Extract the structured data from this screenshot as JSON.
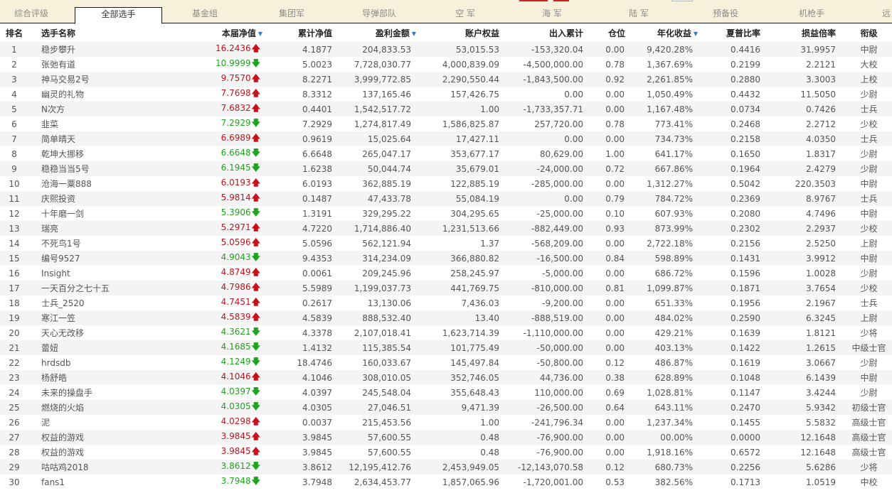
{
  "tabs": [
    {
      "label": "综合评级",
      "active": false
    },
    {
      "label": "全部选手",
      "active": true
    },
    {
      "label": "基金组",
      "active": false
    },
    {
      "label": "集团军",
      "active": false
    },
    {
      "label": "导弹部队",
      "active": false
    },
    {
      "label": "空 军",
      "active": false
    },
    {
      "label": "海 军",
      "active": false
    },
    {
      "label": "陆 军",
      "active": false
    },
    {
      "label": "预备役",
      "active": false
    },
    {
      "label": "机枪手",
      "active": false
    },
    {
      "label": "远",
      "active": false
    }
  ],
  "columns": {
    "rank": "排名",
    "name": "选手名称",
    "nav": "本届净值",
    "cum_nav": "累计净值",
    "profit": "盈利金额",
    "equity": "账户权益",
    "inout": "出入累计",
    "position": "仓位",
    "annual": "年化收益",
    "sharpe": "夏普比率",
    "ratio": "损益倍率",
    "title": "衔级"
  },
  "sorted_columns": [
    "nav",
    "profit",
    "annual"
  ],
  "colors": {
    "up": "#c8121b",
    "down": "#1ea51e",
    "sort_icon": "#2b7bd6",
    "tab_bg": "#f7f1dc"
  },
  "rows": [
    {
      "rank": "1",
      "name": "稳步攀升",
      "nav": "16.2436",
      "dir": "up",
      "cum_nav": "4.1877",
      "profit": "204,833.53",
      "equity": "53,015.53",
      "inout": "-153,320.04",
      "position": "0.00",
      "annual": "9,420.28%",
      "sharpe": "0.4416",
      "ratio": "31.9957",
      "title": "中尉"
    },
    {
      "rank": "2",
      "name": "张弛有道",
      "nav": "10.9999",
      "dir": "down",
      "cum_nav": "5.0023",
      "profit": "7,728,030.77",
      "equity": "4,000,839.09",
      "inout": "-4,500,000.00",
      "position": "0.78",
      "annual": "1,367.69%",
      "sharpe": "0.2199",
      "ratio": "2.2121",
      "title": "大校"
    },
    {
      "rank": "3",
      "name": "神马交易2号",
      "nav": "9.7570",
      "dir": "up",
      "cum_nav": "8.2271",
      "profit": "3,999,772.85",
      "equity": "2,290,550.44",
      "inout": "-1,843,500.00",
      "position": "0.92",
      "annual": "2,261.85%",
      "sharpe": "0.2880",
      "ratio": "3.3003",
      "title": "上校"
    },
    {
      "rank": "4",
      "name": "幽灵的礼物",
      "nav": "7.7698",
      "dir": "up",
      "cum_nav": "8.3312",
      "profit": "137,165.46",
      "equity": "157,426.75",
      "inout": "0.00",
      "position": "0.00",
      "annual": "1,050.49%",
      "sharpe": "0.4432",
      "ratio": "11.5050",
      "title": "少尉"
    },
    {
      "rank": "5",
      "name": "N次方",
      "nav": "7.6832",
      "dir": "up",
      "cum_nav": "0.4401",
      "profit": "1,542,517.72",
      "equity": "1.00",
      "inout": "-1,733,357.71",
      "position": "0.00",
      "annual": "1,167.48%",
      "sharpe": "0.0734",
      "ratio": "0.7426",
      "title": "士兵"
    },
    {
      "rank": "6",
      "name": "韭菜",
      "nav": "7.2929",
      "dir": "down",
      "cum_nav": "7.2929",
      "profit": "1,274,817.49",
      "equity": "1,586,825.87",
      "inout": "257,720.00",
      "position": "0.78",
      "annual": "773.41%",
      "sharpe": "0.2468",
      "ratio": "2.2712",
      "title": "少校"
    },
    {
      "rank": "7",
      "name": "简单晴天",
      "nav": "6.6989",
      "dir": "up",
      "cum_nav": "0.9619",
      "profit": "15,025.64",
      "equity": "17,427.11",
      "inout": "0.00",
      "position": "0.00",
      "annual": "734.73%",
      "sharpe": "0.2158",
      "ratio": "4.0350",
      "title": "士兵"
    },
    {
      "rank": "8",
      "name": "乾坤大挪移",
      "nav": "6.6648",
      "dir": "down",
      "cum_nav": "6.6648",
      "profit": "265,047.17",
      "equity": "353,677.17",
      "inout": "80,629.00",
      "position": "1.00",
      "annual": "641.17%",
      "sharpe": "0.1650",
      "ratio": "1.8317",
      "title": "少尉"
    },
    {
      "rank": "9",
      "name": "稳稳当当5号",
      "nav": "6.1945",
      "dir": "down",
      "cum_nav": "1.6238",
      "profit": "50,044.74",
      "equity": "35,679.01",
      "inout": "-24,000.00",
      "position": "0.72",
      "annual": "667.86%",
      "sharpe": "0.1964",
      "ratio": "2.4279",
      "title": "少尉"
    },
    {
      "rank": "10",
      "name": "沧海一粟888",
      "nav": "6.0193",
      "dir": "up",
      "cum_nav": "6.0193",
      "profit": "362,885.19",
      "equity": "122,885.19",
      "inout": "-285,000.00",
      "position": "0.00",
      "annual": "1,312.27%",
      "sharpe": "0.5042",
      "ratio": "220.3503",
      "title": "中尉"
    },
    {
      "rank": "11",
      "name": "庆熙投资",
      "nav": "5.9814",
      "dir": "up",
      "cum_nav": "0.1487",
      "profit": "47,433.78",
      "equity": "55,084.19",
      "inout": "0.00",
      "position": "0.79",
      "annual": "784.72%",
      "sharpe": "0.2369",
      "ratio": "8.9767",
      "title": "士兵"
    },
    {
      "rank": "12",
      "name": "十年磨一剑",
      "nav": "5.3906",
      "dir": "down",
      "cum_nav": "1.3191",
      "profit": "329,295.22",
      "equity": "304,295.65",
      "inout": "-25,000.00",
      "position": "0.10",
      "annual": "607.93%",
      "sharpe": "0.2080",
      "ratio": "4.7496",
      "title": "中尉"
    },
    {
      "rank": "13",
      "name": "瑞亮",
      "nav": "5.2971",
      "dir": "up",
      "cum_nav": "4.7220",
      "profit": "1,714,886.40",
      "equity": "1,231,513.66",
      "inout": "-882,449.00",
      "position": "0.93",
      "annual": "873.99%",
      "sharpe": "0.2302",
      "ratio": "2.2937",
      "title": "少校"
    },
    {
      "rank": "14",
      "name": "不死鸟1号",
      "nav": "5.0596",
      "dir": "up",
      "cum_nav": "5.0596",
      "profit": "562,121.94",
      "equity": "1.37",
      "inout": "-568,209.00",
      "position": "0.00",
      "annual": "2,722.18%",
      "sharpe": "0.2156",
      "ratio": "2.5250",
      "title": "上尉"
    },
    {
      "rank": "15",
      "name": "编号9527",
      "nav": "4.9043",
      "dir": "down",
      "cum_nav": "9.4353",
      "profit": "314,234.09",
      "equity": "366,880.82",
      "inout": "-16,500.00",
      "position": "0.84",
      "annual": "598.89%",
      "sharpe": "0.1431",
      "ratio": "3.9912",
      "title": "中尉"
    },
    {
      "rank": "16",
      "name": "Insight",
      "nav": "4.8749",
      "dir": "up",
      "cum_nav": "0.0061",
      "profit": "209,245.96",
      "equity": "258,245.97",
      "inout": "-5,000.00",
      "position": "0.00",
      "annual": "686.72%",
      "sharpe": "0.1596",
      "ratio": "1.0028",
      "title": "少尉"
    },
    {
      "rank": "17",
      "name": "一天百分之七十五",
      "nav": "4.7986",
      "dir": "up",
      "cum_nav": "5.5989",
      "profit": "1,199,037.73",
      "equity": "441,769.75",
      "inout": "-810,000.00",
      "position": "0.81",
      "annual": "1,099.87%",
      "sharpe": "0.1871",
      "ratio": "3.7654",
      "title": "少校"
    },
    {
      "rank": "18",
      "name": "士兵_2520",
      "nav": "4.7451",
      "dir": "up",
      "cum_nav": "0.2617",
      "profit": "13,130.06",
      "equity": "7,436.03",
      "inout": "-9,200.00",
      "position": "0.00",
      "annual": "651.33%",
      "sharpe": "0.1956",
      "ratio": "2.1967",
      "title": "士兵"
    },
    {
      "rank": "19",
      "name": "寒江一笠",
      "nav": "4.5839",
      "dir": "up",
      "cum_nav": "4.5839",
      "profit": "888,532.40",
      "equity": "13.40",
      "inout": "-888,519.00",
      "position": "0.00",
      "annual": "484.02%",
      "sharpe": "0.2590",
      "ratio": "6.3245",
      "title": "上尉"
    },
    {
      "rank": "20",
      "name": "天心无改移",
      "nav": "4.3621",
      "dir": "down",
      "cum_nav": "4.3378",
      "profit": "2,107,018.41",
      "equity": "1,623,714.39",
      "inout": "-1,110,000.00",
      "position": "0.00",
      "annual": "429.21%",
      "sharpe": "0.1639",
      "ratio": "1.8121",
      "title": "少将"
    },
    {
      "rank": "21",
      "name": "蕾妞",
      "nav": "4.1685",
      "dir": "down",
      "cum_nav": "1.4132",
      "profit": "115,385.54",
      "equity": "101,775.49",
      "inout": "-50,000.00",
      "position": "0.00",
      "annual": "403.13%",
      "sharpe": "0.1422",
      "ratio": "1.2615",
      "title": "中级士官"
    },
    {
      "rank": "22",
      "name": "hrdsdb",
      "nav": "4.1249",
      "dir": "down",
      "cum_nav": "18.4746",
      "profit": "160,033.67",
      "equity": "145,497.84",
      "inout": "-50,800.00",
      "position": "0.12",
      "annual": "486.87%",
      "sharpe": "0.1619",
      "ratio": "3.0667",
      "title": "少尉"
    },
    {
      "rank": "23",
      "name": "杨舒皓",
      "nav": "4.1046",
      "dir": "up",
      "cum_nav": "4.1046",
      "profit": "308,010.05",
      "equity": "352,746.05",
      "inout": "44,736.00",
      "position": "0.38",
      "annual": "628.89%",
      "sharpe": "0.1048",
      "ratio": "6.1439",
      "title": "中尉"
    },
    {
      "rank": "24",
      "name": "未来的操盘手",
      "nav": "4.0397",
      "dir": "down",
      "cum_nav": "4.0397",
      "profit": "245,548.04",
      "equity": "355,648.43",
      "inout": "110,000.00",
      "position": "0.69",
      "annual": "1,028.81%",
      "sharpe": "0.1147",
      "ratio": "3.4244",
      "title": "少尉"
    },
    {
      "rank": "25",
      "name": "燃烧的火焰",
      "nav": "4.0305",
      "dir": "down",
      "cum_nav": "4.0305",
      "profit": "27,046.51",
      "equity": "9,471.39",
      "inout": "-26,500.00",
      "position": "0.64",
      "annual": "643.11%",
      "sharpe": "0.2470",
      "ratio": "5.9342",
      "title": "初级士官"
    },
    {
      "rank": "26",
      "name": "泥",
      "nav": "4.0298",
      "dir": "up",
      "cum_nav": "0.0037",
      "profit": "215,453.56",
      "equity": "1.00",
      "inout": "-241,796.34",
      "position": "0.00",
      "annual": "1,237.34%",
      "sharpe": "0.1455",
      "ratio": "5.5832",
      "title": "高级士官"
    },
    {
      "rank": "27",
      "name": "权益的游戏",
      "nav": "3.9845",
      "dir": "up",
      "cum_nav": "3.9845",
      "profit": "57,600.55",
      "equity": "0.48",
      "inout": "-76,900.00",
      "position": "0.00",
      "annual": "00.00%",
      "sharpe": "0.0000",
      "ratio": "12.1648",
      "title": "高级士官"
    },
    {
      "rank": "28",
      "name": "权益的游戏",
      "nav": "3.9845",
      "dir": "up",
      "cum_nav": "3.9845",
      "profit": "57,600.55",
      "equity": "0.48",
      "inout": "-76,900.00",
      "position": "0.00",
      "annual": "1,918.16%",
      "sharpe": "0.6572",
      "ratio": "12.1648",
      "title": "高级士官"
    },
    {
      "rank": "29",
      "name": "咕咕鸡2018",
      "nav": "3.8612",
      "dir": "down",
      "cum_nav": "3.8612",
      "profit": "12,195,412.76",
      "equity": "2,453,949.05",
      "inout": "-12,143,070.58",
      "position": "0.12",
      "annual": "680.73%",
      "sharpe": "0.2256",
      "ratio": "5.6286",
      "title": "少将"
    },
    {
      "rank": "30",
      "name": "fans1",
      "nav": "3.7948",
      "dir": "down",
      "cum_nav": "3.7948",
      "profit": "2,634,453.77",
      "equity": "1,857,065.96",
      "inout": "-1,720,001.00",
      "position": "0.53",
      "annual": "382.56%",
      "sharpe": "0.1713",
      "ratio": "1.0519",
      "title": "中校"
    }
  ]
}
